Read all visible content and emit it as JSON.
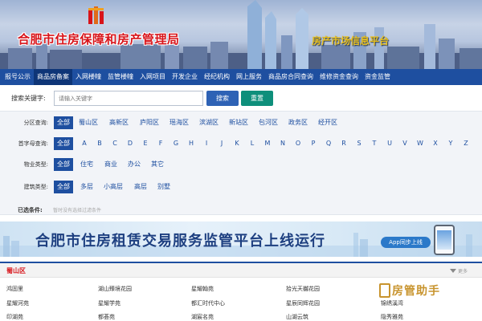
{
  "banner": {
    "title": "合肥市住房保障和房产管理局",
    "subtitle": "房产市场信息平台"
  },
  "nav": {
    "items": [
      "报号公示",
      "商品房备案",
      "入网楼幢",
      "监管楼幢",
      "入网项目",
      "开发企业",
      "经纪机构",
      "网上服务",
      "商品房合同查询",
      "维修资金查询",
      "资金监管"
    ],
    "active_index": 1
  },
  "search": {
    "label": "搜索关键字:",
    "placeholder": "请输入关键字",
    "search_label": "搜索",
    "reset_label": "重置"
  },
  "filters": {
    "district": {
      "label": "分区查询:",
      "options": [
        "全部",
        "蜀山区",
        "高新区",
        "庐阳区",
        "瑶海区",
        "滨湖区",
        "新站区",
        "包河区",
        "政务区",
        "经开区"
      ]
    },
    "initial": {
      "label": "首字母查询:",
      "options": [
        "全部",
        "A",
        "B",
        "C",
        "D",
        "E",
        "F",
        "G",
        "H",
        "I",
        "J",
        "K",
        "L",
        "M",
        "N",
        "O",
        "P",
        "Q",
        "R",
        "S",
        "T",
        "U",
        "V",
        "W",
        "X",
        "Y",
        "Z"
      ]
    },
    "property_type": {
      "label": "物业类型:",
      "options": [
        "全部",
        "住宅",
        "商业",
        "办公",
        "其它"
      ]
    },
    "building_type": {
      "label": "建筑类型:",
      "options": [
        "全部",
        "多层",
        "小高层",
        "高层",
        "别墅"
      ]
    },
    "conditions_label": "已选条件:",
    "conditions_text": "暂时没有选择过滤条件"
  },
  "ad": {
    "title": "合肥市住房租赁交易服务监管平台上线运行",
    "app_label": "App同步上线"
  },
  "section": {
    "title": "蜀山区",
    "more_label": "更多",
    "listings": [
      [
        "鸿固里",
        "湖山臻境花园",
        "星耀翰苑",
        "拾光天樾花园"
      ],
      [
        "星耀河苑",
        "星耀学苑",
        "都汇时代中心",
        "星辰同辉花园",
        "锦绣溪湾"
      ],
      [
        "印湖苑",
        "都荟苑",
        "湖宸名苑",
        "山湖云筑",
        "隐秀雅苑"
      ]
    ]
  },
  "watermark": {
    "text": "房管助手"
  },
  "colors": {
    "nav_bg": "#1e4fa0",
    "nav_active": "#0e3577",
    "title_red": "#d8141a",
    "subtitle_gold": "#e8c020",
    "reset_green": "#0e8f7b",
    "link_blue": "#1e4fa0"
  }
}
